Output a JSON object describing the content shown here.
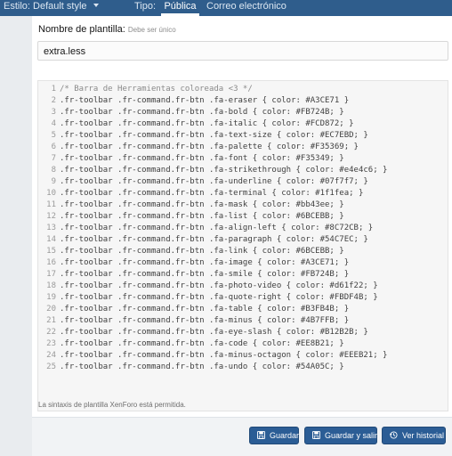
{
  "topbar": {
    "style_label": "Estilo: Default style",
    "type_label": "Tipo:",
    "tabs": [
      {
        "label": "Pública",
        "active": true
      },
      {
        "label": "Correo electrónico",
        "active": false
      }
    ],
    "background_color": "#2f5d8c"
  },
  "form": {
    "name_label": "Nombre de plantilla:",
    "name_hint": "Debe ser único",
    "name_value": "extra.less",
    "helper_text": "La sintaxis de plantilla XenForo está permitida."
  },
  "editor": {
    "lines": [
      {
        "num": "1",
        "text": "/* Barra de Herramientas coloreada <3 */"
      },
      {
        "num": "2",
        "text": ".fr-toolbar .fr-command.fr-btn .fa-eraser { color: #A3CE71 }"
      },
      {
        "num": "3",
        "text": ".fr-toolbar .fr-command.fr-btn .fa-bold { color: #FB724B; }"
      },
      {
        "num": "4",
        "text": ".fr-toolbar .fr-command.fr-btn .fa-italic { color: #FCD872; }"
      },
      {
        "num": "5",
        "text": ".fr-toolbar .fr-command.fr-btn .fa-text-size { color: #EC7EBD; }"
      },
      {
        "num": "6",
        "text": ".fr-toolbar .fr-command.fr-btn .fa-palette { color: #F35369; }"
      },
      {
        "num": "7",
        "text": ".fr-toolbar .fr-command.fr-btn .fa-font { color: #F35349; }"
      },
      {
        "num": "8",
        "text": ".fr-toolbar .fr-command.fr-btn .fa-strikethrough { color: #e4e4c6; }"
      },
      {
        "num": "9",
        "text": ".fr-toolbar .fr-command.fr-btn .fa-underline { color: #07f7f7; }"
      },
      {
        "num": "10",
        "text": ".fr-toolbar .fr-command.fr-btn .fa-terminal { color: #1f1fea; }"
      },
      {
        "num": "11",
        "text": ".fr-toolbar .fr-command.fr-btn .fa-mask { color: #bb43ee; }"
      },
      {
        "num": "12",
        "text": ".fr-toolbar .fr-command.fr-btn .fa-list { color: #6BCEBB; }"
      },
      {
        "num": "13",
        "text": ".fr-toolbar .fr-command.fr-btn .fa-align-left { color: #8C72CB; }"
      },
      {
        "num": "14",
        "text": ".fr-toolbar .fr-command.fr-btn .fa-paragraph { color: #54C7EC; }"
      },
      {
        "num": "15",
        "text": ".fr-toolbar .fr-command.fr-btn .fa-link { color: #6BCEBB; }"
      },
      {
        "num": "16",
        "text": ".fr-toolbar .fr-command.fr-btn .fa-image { color: #A3CE71; }"
      },
      {
        "num": "17",
        "text": ".fr-toolbar .fr-command.fr-btn .fa-smile { color: #FB724B; }"
      },
      {
        "num": "18",
        "text": ".fr-toolbar .fr-command.fr-btn .fa-photo-video { color: #d61f22; }"
      },
      {
        "num": "19",
        "text": ".fr-toolbar .fr-command.fr-btn .fa-quote-right { color: #FBDF4B; }"
      },
      {
        "num": "20",
        "text": ".fr-toolbar .fr-command.fr-btn .fa-table { color: #B3FB4B; }"
      },
      {
        "num": "21",
        "text": ".fr-toolbar .fr-command.fr-btn .fa-minus { color: #4B7FFB; }"
      },
      {
        "num": "22",
        "text": ".fr-toolbar .fr-command.fr-btn .fa-eye-slash { color: #B12B2B; }"
      },
      {
        "num": "23",
        "text": ".fr-toolbar .fr-command.fr-btn .fa-code { color: #EE8B21; }"
      },
      {
        "num": "24",
        "text": ".fr-toolbar .fr-command.fr-btn .fa-minus-octagon { color: #EEEB21; }"
      },
      {
        "num": "25",
        "text": ".fr-toolbar .fr-command.fr-btn .fa-undo { color: #54A05C; }"
      }
    ]
  },
  "buttons": {
    "save": {
      "label": "Guardar",
      "icon": "save-icon"
    },
    "save_exit": {
      "label": "Guardar y salir",
      "icon": "save-icon"
    },
    "history": {
      "label": "Ver historial",
      "icon": "history-icon"
    },
    "color": "#2b5d95"
  }
}
